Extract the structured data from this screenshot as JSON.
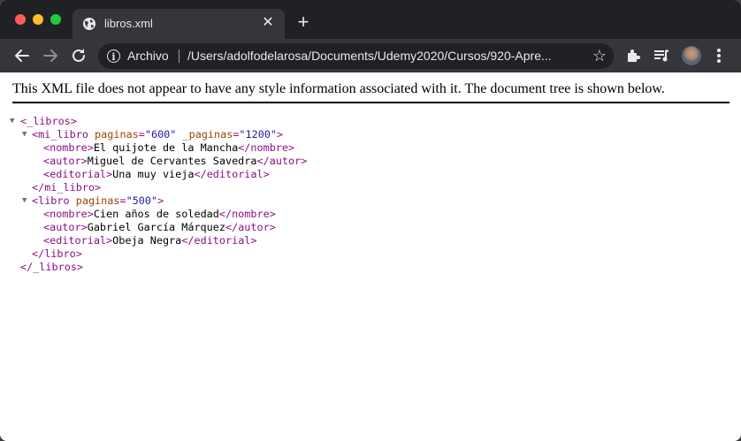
{
  "browser": {
    "tab_title": "libros.xml",
    "tab_close": "✕",
    "new_tab": "+",
    "site_chip": "Archivo",
    "url": "/Users/adolfodelarosa/Documents/Udemy2020/Cursos/920-Apre..."
  },
  "page": {
    "header": "This XML file does not appear to have any style information associated with it. The document tree is shown below.",
    "xml": {
      "root_open": "<_libros>",
      "root_close": "</_libros>",
      "libro1": {
        "open_tag": "<mi_libro",
        "attr1_name": "paginas",
        "attr1_value": "\"600\"",
        "attr2_name": "_paginas",
        "attr2_value": "\"1200\"",
        "open_end": ">",
        "nombre_open": "<nombre>",
        "nombre": "El quijote de la Mancha",
        "nombre_close": "</nombre>",
        "autor_open": "<autor>",
        "autor": "Miguel de Cervantes Savedra",
        "autor_close": "</autor>",
        "editorial_open": "<editorial>",
        "editorial": "Una muy vieja",
        "editorial_close": "</editorial>",
        "close_tag": "</mi_libro>"
      },
      "libro2": {
        "open_tag": "<libro",
        "attr1_name": "paginas",
        "attr1_value": "\"500\"",
        "open_end": ">",
        "nombre_open": "<nombre>",
        "nombre": "Cien años de soledad",
        "nombre_close": "</nombre>",
        "autor_open": "<autor>",
        "autor": "Gabriel García Márquez",
        "autor_close": "</autor>",
        "editorial_open": "<editorial>",
        "editorial": "Obeja Negra",
        "editorial_close": "</editorial>",
        "close_tag": "</libro>"
      }
    }
  },
  "colors": {
    "tag": "#881280",
    "attr_name": "#994500",
    "attr_value": "#1a1aa6",
    "chrome_dark": "#202124",
    "chrome_toolbar": "#35363a"
  },
  "icons": [
    "globe-icon",
    "close-icon",
    "plus-icon",
    "back-icon",
    "forward-icon",
    "reload-icon",
    "info-icon",
    "star-icon",
    "extensions-icon",
    "media-icon",
    "avatar",
    "menu-icon",
    "collapse-arrow-icon"
  ]
}
